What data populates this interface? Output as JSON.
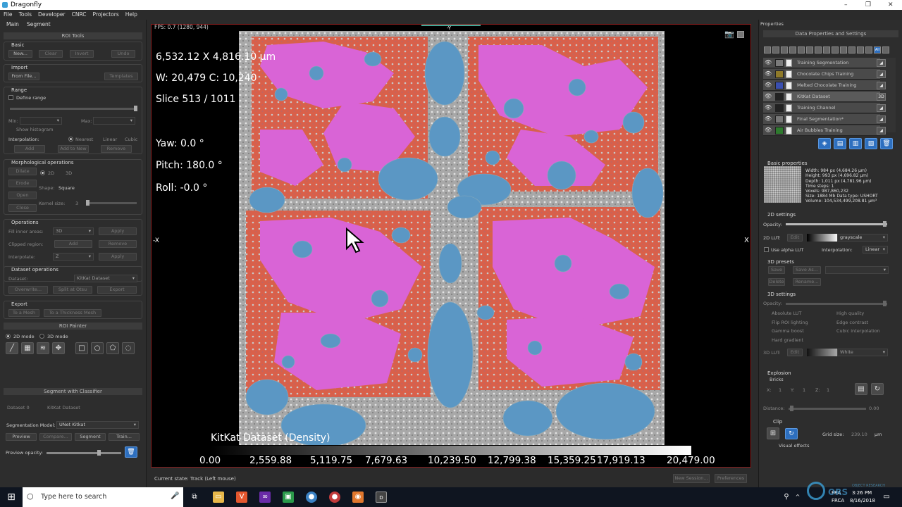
{
  "titlebar": {
    "title": "Dragonfly",
    "minimize": "–",
    "maximize": "❐",
    "close": "✕"
  },
  "menu": [
    "File",
    "Tools",
    "Developer",
    "CNRC",
    "Projectors",
    "Help"
  ],
  "left": {
    "tabs": [
      "Main",
      "Segment"
    ],
    "roi_tools": "ROI Tools",
    "basic": {
      "title": "Basic",
      "new": "New...",
      "clear": "Clear",
      "invert": "Invert",
      "undo": "Undo"
    },
    "import": {
      "title": "Import",
      "from_file": "From File...",
      "templates": "Templates"
    },
    "range": {
      "title": "Range",
      "define": "Define range",
      "min": "Min:",
      "max": "Max:",
      "show_histogram": "Show histogram",
      "interpolation": "Interpolation:",
      "nearest": "Nearest",
      "linear": "Linear",
      "cubic": "Cubic",
      "add": "Add",
      "add_to_new": "Add to New",
      "remove": "Remove"
    },
    "morph": {
      "title": "Morphological operations",
      "dilate": "Dilate",
      "erode": "Erode",
      "open": "Open",
      "close": "Close",
      "d2": "2D",
      "d3": "3D",
      "shape_label": "Shape:",
      "shape_value": "Square",
      "kernel_label": "Kernel size:",
      "kernel_value": "3"
    },
    "operations": {
      "title": "Operations",
      "fill_label": "Fill inner areas:",
      "fill_value": "3D",
      "apply": "Apply",
      "clipped_label": "Clipped region:",
      "add": "Add",
      "remove": "Remove",
      "interp_label": "Interpolate:",
      "interp_value": "Z"
    },
    "dataset_ops": {
      "title": "Dataset operations",
      "dataset_label": "Dataset:",
      "dataset_value": "KitKat Dataset",
      "overwrite": "Overwrite...",
      "split": "Split at Otsu",
      "export": "Export"
    },
    "export": {
      "title": "Export",
      "to_mesh": "To a Mesh",
      "to_thickness": "To a Thickness Mesh"
    },
    "painter": {
      "title": "ROI Painter",
      "mode2d": "2D mode",
      "mode3d": "3D mode"
    },
    "classifier": {
      "title": "Segment with Classifier",
      "dataset_label": "Dataset 0",
      "dataset_value": "KitKat Dataset",
      "model_label": "Segmentation Model:",
      "model_value": "UNet Kitkat",
      "preview": "Preview",
      "compare": "Compare...",
      "segment": "Segment",
      "train": "Train...",
      "opacity": "Preview opacity:"
    }
  },
  "viewer": {
    "fps": "FPS: 0.7   (1280, 944)",
    "coords": "6,532.12 X 4,816.10 µm",
    "wc": "W: 20,479 C: 10,240",
    "slice": "Slice 513 / 1011",
    "yaw": "Yaw: 0.0 °",
    "pitch": "Pitch: 180.0 °",
    "roll": "Roll: -0.0 °",
    "axis_x": "-X",
    "axis_x2": "X",
    "axis_top": "-Y",
    "colorbar_title": "KitKat Dataset (Density)",
    "ticks": [
      "0.00",
      "2,559.88",
      "5,119.75",
      "7,679.63",
      "10,239.50",
      "12,799.38",
      "15,359.25",
      "17,919.13",
      "20,479.00"
    ],
    "colors": {
      "pink": "#d964d6",
      "red": "#d9604a",
      "blue": "#5b97c4",
      "gray": "#a7a7a7"
    }
  },
  "status": {
    "state": "Current state: Track (Left mouse)",
    "new_session": "New Session...",
    "preferences": "Preferences"
  },
  "right": {
    "header": "Properties",
    "subheader": "Data Properties and Settings",
    "all": "All",
    "layers": [
      {
        "name": "Training Segmentation",
        "color": "#7a7a7a",
        "tag": "◢",
        "sel": false
      },
      {
        "name": "Chocolate Chips Training",
        "color": "#8f7a2a",
        "tag": "◢",
        "sel": false
      },
      {
        "name": "Melted Chocolate Training",
        "color": "#3a4fb0",
        "tag": "◢",
        "sel": false
      },
      {
        "name": "KitKat Dataset",
        "color": "#222222",
        "tag": "3D",
        "sel": true
      },
      {
        "name": "Training Channel",
        "color": "#222222",
        "tag": "◢",
        "sel": false
      },
      {
        "name": "Final Segmentation*",
        "color": "#777777",
        "tag": "◢",
        "sel": false
      },
      {
        "name": "Air Bubbles Training",
        "color": "#2e7a2e",
        "tag": "◢",
        "sel": false
      }
    ],
    "basic": {
      "title": "Basic properties",
      "lines": [
        "Width: 984 px (4,684.26 µm)",
        "Height: 993 px (4,696.82 µm)",
        "Depth: 1,011 px (4,781.96 µm)",
        "Time steps: 1",
        "Voxels: 987,860,232",
        "Size: 1884 Mb  Data type: USHORT",
        "Volume: 104,534,499,208.81 µm³"
      ]
    },
    "s2d": {
      "title": "2D settings",
      "opacity": "Opacity:",
      "lut": "2D LUT:",
      "edit": "Edit",
      "lut_value": "grayscale",
      "alpha": "Use alpha LUT",
      "interp": "Interpolation:",
      "interp_value": "Linear"
    },
    "presets": {
      "title": "3D presets",
      "save": "Save",
      "save_as": "Save As...",
      "delete": "Delete",
      "rename": "Rename..."
    },
    "s3d": {
      "title": "3D settings",
      "opacity": "Opacity:",
      "absolute": "Absolute LUT",
      "high": "High quality",
      "flip": "Flip ROI lighting",
      "edge": "Edge contrast",
      "gamma": "Gamma boost",
      "cubic": "Cubic interpolation",
      "hard": "Hard gradient",
      "lut": "3D LUT:",
      "edit": "Edit",
      "lut_value": "White"
    },
    "explosion": {
      "title": "Explosion",
      "bricks": "Bricks",
      "x": "X:",
      "y": "Y:",
      "z": "Z:",
      "one": "1",
      "distance": "Distance:",
      "distance_value": "0.00"
    },
    "clip": {
      "title": "Clip",
      "grid": "Grid size:",
      "grid_value": "239.10",
      "unit": "µm",
      "visual": "Visual effects"
    }
  },
  "taskbar": {
    "search": "Type here to search",
    "lang1": "FRA",
    "lang2": "FRCA",
    "time": "3:26 PM",
    "date": "8/16/2018",
    "brand": "ORS",
    "brand_sub": "OBJECT RESEARCH"
  }
}
